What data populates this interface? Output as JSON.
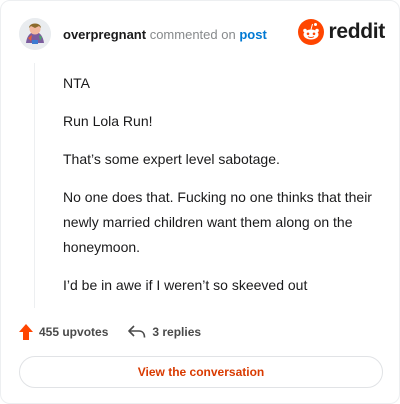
{
  "header": {
    "username": "overpregnant",
    "action_text": "commented on",
    "post_link": "post",
    "brand": "reddit"
  },
  "comment": {
    "paragraphs": [
      "NTA",
      "Run Lola Run!",
      "That’s some expert level sabotage.",
      "No one does that. Fucking no one thinks that their newly married children want them along on the honeymoon.",
      "I’d be in awe if I weren’t so skeeved out"
    ]
  },
  "actions": {
    "upvotes": "455 upvotes",
    "replies": "3 replies"
  },
  "cta": {
    "label": "View the conversation"
  },
  "colors": {
    "brand_orange": "#ff4500",
    "link_blue": "#0079d3",
    "cta_text": "#d93a00"
  },
  "icons": [
    "avatar",
    "reddit-logo-icon",
    "upvote-icon",
    "reply-icon"
  ]
}
